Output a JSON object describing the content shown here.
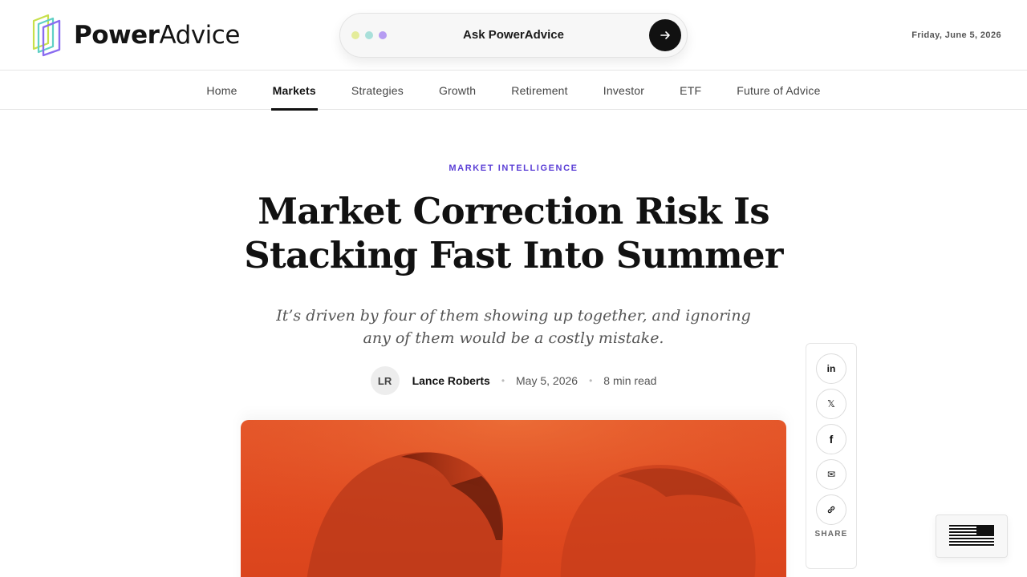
{
  "brand": {
    "name_bold": "Power",
    "name_light": "Advice",
    "logo_colors": [
      "#c7e04a",
      "#5fd0c4",
      "#8a6cf0"
    ]
  },
  "ask": {
    "label": "Ask PowerAdvice",
    "dot_colors": [
      "#e4ec9a",
      "#a9e0da",
      "#b69cf2"
    ],
    "submit_icon": "arrow-right-icon"
  },
  "header": {
    "date": "Friday, June 5, 2026"
  },
  "nav": {
    "items": [
      {
        "label": "Home"
      },
      {
        "label": "Markets",
        "active": true
      },
      {
        "label": "Strategies"
      },
      {
        "label": "Growth"
      },
      {
        "label": "Retirement"
      },
      {
        "label": "Investor"
      },
      {
        "label": "ETF"
      },
      {
        "label": "Future of Advice"
      }
    ]
  },
  "article": {
    "kicker": "MARKET INTELLIGENCE",
    "headline": "Market Correction Risk Is Stacking Fast Into Summer",
    "dek": "It’s driven by four of them showing up together, and ignoring any of them would be a costly mistake.",
    "author_initials": "LR",
    "author": "Lance Roberts",
    "date": "May 5, 2026",
    "read_time": "8 min read",
    "separator": "•"
  },
  "share": {
    "label": "SHARE",
    "buttons": [
      {
        "icon": "linkedin-icon",
        "glyph": "in"
      },
      {
        "icon": "x-icon",
        "glyph": "𝕏"
      },
      {
        "icon": "facebook-icon",
        "glyph": "f"
      },
      {
        "icon": "mail-icon",
        "glyph": "✉"
      },
      {
        "icon": "link-icon",
        "glyph": "🔗"
      }
    ]
  },
  "colors": {
    "accent": "#5b3fd6",
    "hero_orange": "#e0491f"
  }
}
